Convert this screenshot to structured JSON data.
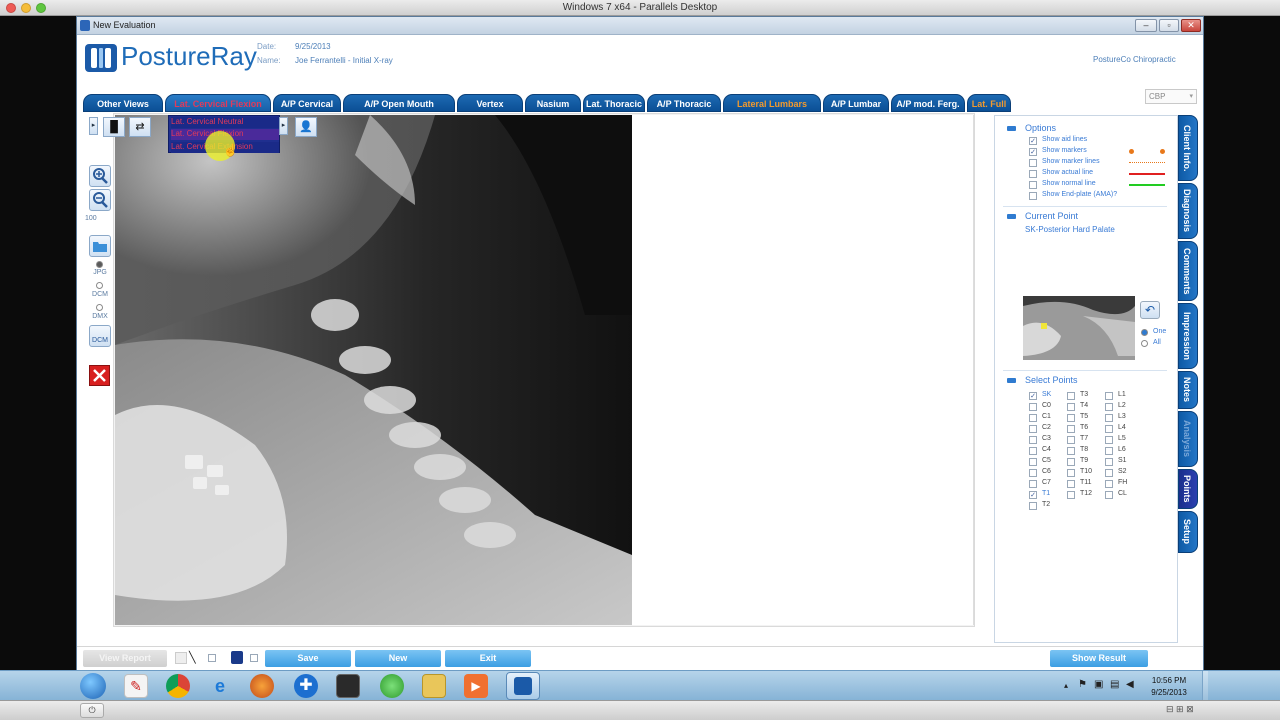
{
  "host": {
    "title": "Windows 7 x64 - Parallels Desktop"
  },
  "window": {
    "title": "New Evaluation",
    "controls": [
      "minimize",
      "restore",
      "close"
    ]
  },
  "header": {
    "logo_text": "PostureRay",
    "date_label": "Date:",
    "date_value": "9/25/2013",
    "name_label": "Name:",
    "name_value": "Joe Ferrantelli - Initial X-ray",
    "clinic": "PostureCo Chiropractic",
    "analysis_select": "CBP"
  },
  "tabs": [
    {
      "label": "Other Views",
      "color": "white"
    },
    {
      "label": "Lat. Cervical Flexion",
      "color": "red"
    },
    {
      "label": "A/P Cervical",
      "color": "white"
    },
    {
      "label": "A/P Open Mouth",
      "color": "white"
    },
    {
      "label": "Vertex",
      "color": "white"
    },
    {
      "label": "Nasium",
      "color": "white"
    },
    {
      "label": "Lat. Thoracic",
      "color": "white"
    },
    {
      "label": "A/P Thoracic",
      "color": "white"
    },
    {
      "label": "Lateral Lumbars",
      "color": "orange"
    },
    {
      "label": "A/P Lumbar",
      "color": "white"
    },
    {
      "label": "A/P mod. Ferg.",
      "color": "white"
    },
    {
      "label": "Lat. Full",
      "color": "orange"
    }
  ],
  "view_dropdown": {
    "items": [
      "Lat. Cervical Neutral",
      "Lat. Cervical Flexion",
      "Lat. Cervical Extension"
    ]
  },
  "left_toolbar": {
    "zoom_level": "100",
    "formats": [
      "JPG",
      "DCM",
      "DMX"
    ],
    "dcm_button": "DCM"
  },
  "options": {
    "title": "Options",
    "items": [
      {
        "label": "Show aid lines",
        "checked": true,
        "color": ""
      },
      {
        "label": "Show markers",
        "checked": true,
        "color": "#e8781a"
      },
      {
        "label": "Show marker lines",
        "checked": false,
        "color": "#e8781a"
      },
      {
        "label": "Show actual line",
        "checked": false,
        "color": "#e02020"
      },
      {
        "label": "Show normal line",
        "checked": false,
        "color": "#22cc22"
      },
      {
        "label": "Show End-plate (AMA)?",
        "checked": false,
        "color": ""
      }
    ]
  },
  "current_point": {
    "title": "Current Point",
    "value": "SK-Posterior Hard Palate",
    "radio_one": "One",
    "radio_all": "All"
  },
  "select_points": {
    "title": "Select Points",
    "col1": [
      {
        "label": "SK",
        "checked": true
      },
      {
        "label": "C0",
        "checked": false
      },
      {
        "label": "C1",
        "checked": false
      },
      {
        "label": "C2",
        "checked": false
      },
      {
        "label": "C3",
        "checked": false
      },
      {
        "label": "C4",
        "checked": false
      },
      {
        "label": "C5",
        "checked": false
      },
      {
        "label": "C6",
        "checked": false
      },
      {
        "label": "C7",
        "checked": false
      },
      {
        "label": "T1",
        "checked": true
      },
      {
        "label": "T2",
        "checked": false
      }
    ],
    "col2": [
      {
        "label": "T3",
        "checked": false
      },
      {
        "label": "T4",
        "checked": false
      },
      {
        "label": "T5",
        "checked": false
      },
      {
        "label": "T6",
        "checked": false
      },
      {
        "label": "T7",
        "checked": false
      },
      {
        "label": "T8",
        "checked": false
      },
      {
        "label": "T9",
        "checked": false
      },
      {
        "label": "T10",
        "checked": false
      },
      {
        "label": "T11",
        "checked": false
      },
      {
        "label": "T12",
        "checked": false
      }
    ],
    "col3": [
      {
        "label": "L1",
        "checked": false
      },
      {
        "label": "L2",
        "checked": false
      },
      {
        "label": "L3",
        "checked": false
      },
      {
        "label": "L4",
        "checked": false
      },
      {
        "label": "L5",
        "checked": false
      },
      {
        "label": "L6",
        "checked": false
      },
      {
        "label": "S1",
        "checked": false
      },
      {
        "label": "S2",
        "checked": false
      },
      {
        "label": "FH",
        "checked": false
      },
      {
        "label": "CL",
        "checked": false
      }
    ]
  },
  "side_tabs": [
    {
      "label": "Client Info.",
      "state": "normal"
    },
    {
      "label": "Diagnosis",
      "state": "normal"
    },
    {
      "label": "Comments",
      "state": "normal"
    },
    {
      "label": "Impression",
      "state": "normal"
    },
    {
      "label": "Notes",
      "state": "normal"
    },
    {
      "label": "Analysis",
      "state": "dim"
    },
    {
      "label": "Points",
      "state": "selected"
    },
    {
      "label": "Setup",
      "state": "normal"
    }
  ],
  "bottom": {
    "view_report": "View Report",
    "save": "Save",
    "new": "New",
    "exit": "Exit",
    "show_result": "Show Result"
  },
  "taskbar": {
    "time": "10:56 PM",
    "date": "9/25/2013",
    "apps": [
      "start-orb",
      "paint",
      "chrome",
      "ie",
      "firefox",
      "medical-app",
      "xray-app",
      "messenger",
      "explorer",
      "media-player",
      "postureray"
    ]
  }
}
